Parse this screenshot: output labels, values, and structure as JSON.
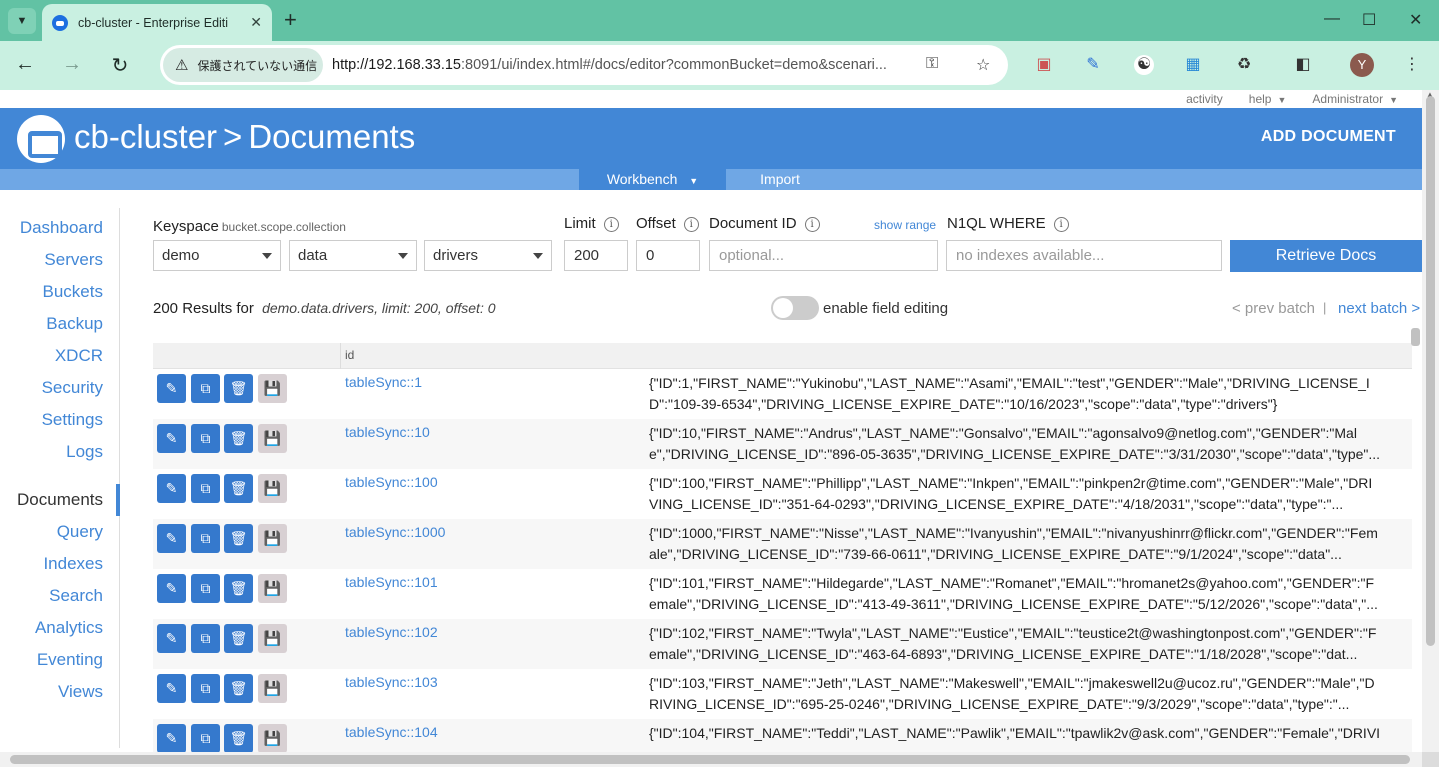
{
  "browser": {
    "tab_title": "cb-cluster - Enterprise Edition",
    "security_label": "保護されていない通信",
    "url_host": "http://192.168.33.15",
    "url_rest": ":8091/ui/index.html#/docs/editor?commonBucket=demo&scenari...",
    "profile_initial": "Y"
  },
  "util": {
    "activity": "activity",
    "help": "help",
    "admin": "Administrator"
  },
  "header": {
    "cluster": "cb-cluster",
    "separator": ">",
    "page": "Documents",
    "add_document": "ADD DOCUMENT"
  },
  "subnav": {
    "workbench": "Workbench",
    "import": "Import"
  },
  "sidebar": {
    "items": [
      "Dashboard",
      "Servers",
      "Buckets",
      "Backup",
      "XDCR",
      "Security",
      "Settings",
      "Logs",
      "Documents",
      "Query",
      "Indexes",
      "Search",
      "Analytics",
      "Eventing",
      "Views"
    ],
    "active": "Documents"
  },
  "filters": {
    "keyspace_label": "Keyspace",
    "keyspace_hint": "bucket.scope.collection",
    "bucket": "demo",
    "scope": "data",
    "collection": "drivers",
    "limit_label": "Limit",
    "limit": "200",
    "offset_label": "Offset",
    "offset": "0",
    "docid_label": "Document ID",
    "docid_placeholder": "optional...",
    "show_range": "show range",
    "where_label": "N1QL WHERE",
    "where_placeholder": "no indexes available...",
    "retrieve": "Retrieve Docs"
  },
  "results": {
    "summary": "200 Results for",
    "detail": "demo.data.drivers, limit: 200, offset: 0",
    "field_editing": "enable field editing",
    "prev_batch": "< prev batch",
    "divider": "|",
    "next_batch": "next batch >"
  },
  "table": {
    "column_id": "id",
    "rows": [
      {
        "id": "tableSync::1",
        "json": "{\"ID\":1,\"FIRST_NAME\":\"Yukinobu\",\"LAST_NAME\":\"Asami\",\"EMAIL\":\"test\",\"GENDER\":\"Male\",\"DRIVING_LICENSE_ID\":\"109-39-6534\",\"DRIVING_LICENSE_EXPIRE_DATE\":\"10/16/2023\",\"scope\":\"data\",\"type\":\"drivers\"}"
      },
      {
        "id": "tableSync::10",
        "json": "{\"ID\":10,\"FIRST_NAME\":\"Andrus\",\"LAST_NAME\":\"Gonsalvo\",\"EMAIL\":\"agonsalvo9@netlog.com\",\"GENDER\":\"Male\",\"DRIVING_LICENSE_ID\":\"896-05-3635\",\"DRIVING_LICENSE_EXPIRE_DATE\":\"3/31/2030\",\"scope\":\"data\",\"type\"..."
      },
      {
        "id": "tableSync::100",
        "json": "{\"ID\":100,\"FIRST_NAME\":\"Phillipp\",\"LAST_NAME\":\"Inkpen\",\"EMAIL\":\"pinkpen2r@time.com\",\"GENDER\":\"Male\",\"DRIVING_LICENSE_ID\":\"351-64-0293\",\"DRIVING_LICENSE_EXPIRE_DATE\":\"4/18/2031\",\"scope\":\"data\",\"type\":\"..."
      },
      {
        "id": "tableSync::1000",
        "json": "{\"ID\":1000,\"FIRST_NAME\":\"Nisse\",\"LAST_NAME\":\"Ivanyushin\",\"EMAIL\":\"nivanyushinrr@flickr.com\",\"GENDER\":\"Female\",\"DRIVING_LICENSE_ID\":\"739-66-0611\",\"DRIVING_LICENSE_EXPIRE_DATE\":\"9/1/2024\",\"scope\":\"data\"..."
      },
      {
        "id": "tableSync::101",
        "json": "{\"ID\":101,\"FIRST_NAME\":\"Hildegarde\",\"LAST_NAME\":\"Romanet\",\"EMAIL\":\"hromanet2s@yahoo.com\",\"GENDER\":\"Female\",\"DRIVING_LICENSE_ID\":\"413-49-3611\",\"DRIVING_LICENSE_EXPIRE_DATE\":\"5/12/2026\",\"scope\":\"data\",\"..."
      },
      {
        "id": "tableSync::102",
        "json": "{\"ID\":102,\"FIRST_NAME\":\"Twyla\",\"LAST_NAME\":\"Eustice\",\"EMAIL\":\"teustice2t@washingtonpost.com\",\"GENDER\":\"Female\",\"DRIVING_LICENSE_ID\":\"463-64-6893\",\"DRIVING_LICENSE_EXPIRE_DATE\":\"1/18/2028\",\"scope\":\"dat..."
      },
      {
        "id": "tableSync::103",
        "json": "{\"ID\":103,\"FIRST_NAME\":\"Jeth\",\"LAST_NAME\":\"Makeswell\",\"EMAIL\":\"jmakeswell2u@ucoz.ru\",\"GENDER\":\"Male\",\"DRIVING_LICENSE_ID\":\"695-25-0246\",\"DRIVING_LICENSE_EXPIRE_DATE\":\"9/3/2029\",\"scope\":\"data\",\"type\":\"..."
      },
      {
        "id": "tableSync::104",
        "json": "{\"ID\":104,\"FIRST_NAME\":\"Teddi\",\"LAST_NAME\":\"Pawlik\",\"EMAIL\":\"tpawlik2v@ask.com\",\"GENDER\":\"Female\",\"DRIVI"
      }
    ]
  },
  "icons": {
    "edit": "pencil-icon",
    "copy": "copy-icon",
    "delete": "trash-icon",
    "save": "save-icon"
  },
  "colors": {
    "brand": "#4287d6",
    "chrome": "#62c2a4",
    "action_button": "#3579cd",
    "disabled_button": "#d8d0d3"
  }
}
